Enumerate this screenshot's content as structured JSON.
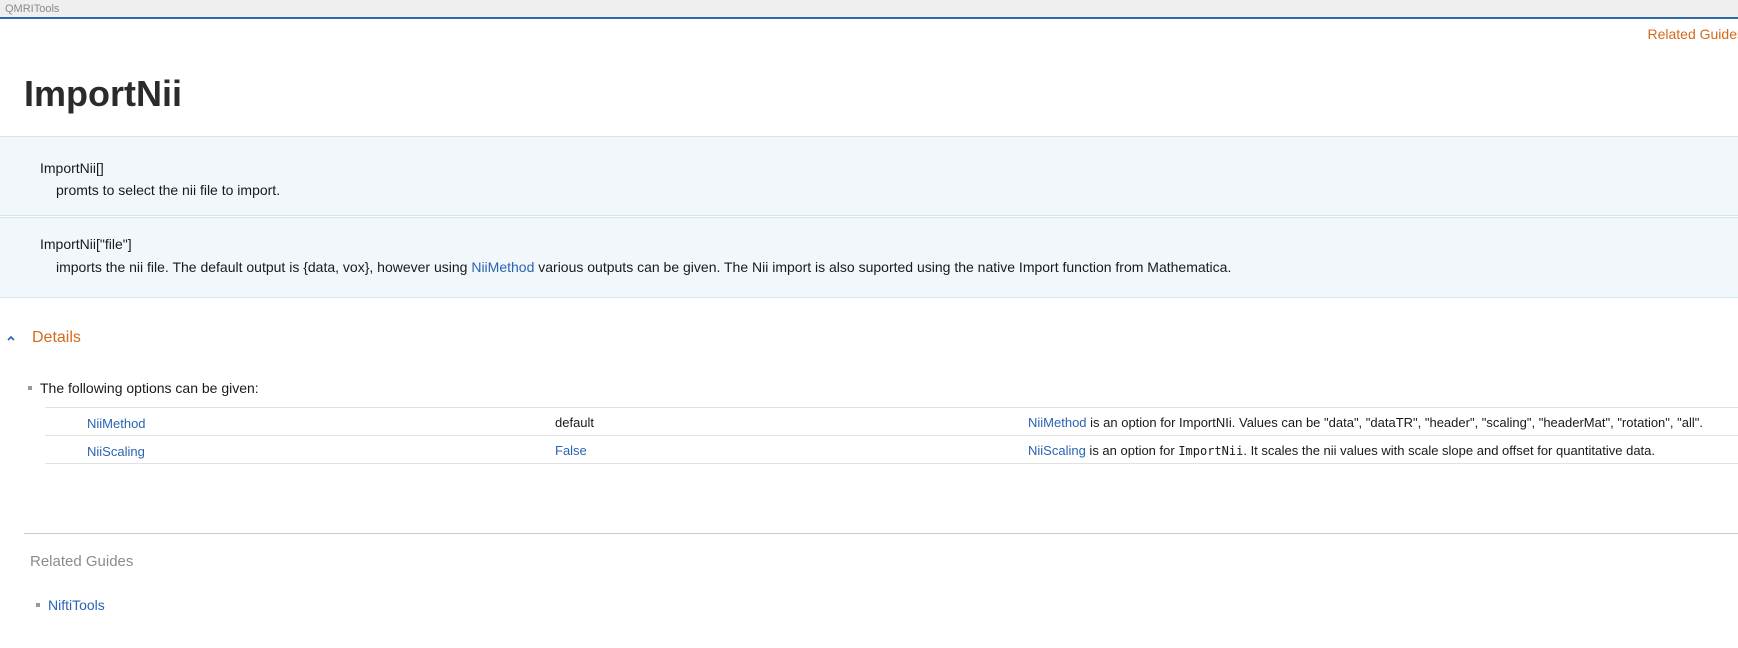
{
  "app": {
    "name": "QMRITools"
  },
  "header": {
    "related_link": "Related Guides"
  },
  "page": {
    "title": "ImportNii"
  },
  "usages": [
    {
      "signature": "ImportNii[]",
      "description": "promts to select the nii file to import."
    },
    {
      "signature": "ImportNii[\"file\"]",
      "description_before": "imports the nii file. The default output is {data, vox}, however using ",
      "description_link": "NiiMethod",
      "description_after": " various outputs can be given. The Nii import is also suported using the native Import function from Mathematica."
    }
  ],
  "details": {
    "title": "Details",
    "options_intro": "The following options can be given:",
    "options": [
      {
        "name": "NiiMethod",
        "default": "default",
        "desc_link": "NiiMethod",
        "desc_text": " is an option for ImportNIi. Values can be \"data\", \"dataTR\", \"header\", \"scaling\", \"headerMat\", \"rotation\", \"all\"."
      },
      {
        "name": "NiiScaling",
        "default": "False",
        "desc_link": "NiiScaling",
        "desc_text_before": " is an option for ",
        "desc_code": "ImportNii",
        "desc_text_after": ". It scales the nii values with scale slope and offset for quantitative data."
      }
    ]
  },
  "related_guides": {
    "title": "Related Guides",
    "items": [
      {
        "label": "NiftiTools"
      }
    ]
  },
  "colors": {
    "accent_orange": "#d46a1c",
    "link_blue": "#2a63b3",
    "usage_bg": "#f1f7fa",
    "topbar_border": "#2f6aa8"
  }
}
